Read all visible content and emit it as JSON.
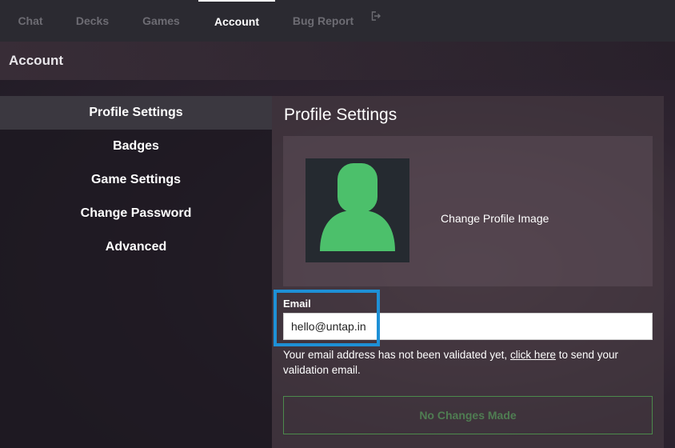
{
  "nav": {
    "items": [
      {
        "label": "Chat"
      },
      {
        "label": "Decks"
      },
      {
        "label": "Games"
      },
      {
        "label": "Account"
      },
      {
        "label": "Bug Report"
      }
    ],
    "logout_icon": "logout-icon"
  },
  "header": {
    "title": "Account"
  },
  "sidebar": {
    "items": [
      {
        "label": "Profile Settings"
      },
      {
        "label": "Badges"
      },
      {
        "label": "Game Settings"
      },
      {
        "label": "Change Password"
      },
      {
        "label": "Advanced"
      }
    ]
  },
  "content": {
    "title": "Profile Settings",
    "avatar_icon": "user-silhouette-icon",
    "avatar_color": "#4cc06b",
    "change_image_label": "Change Profile Image",
    "email_label": "Email",
    "email_value": "hello@untap.in",
    "notice_before": "Your email address has not been validated yet, ",
    "notice_link": "click here",
    "notice_after": " to send your validation email.",
    "save_label": "No Changes Made"
  },
  "colors": {
    "highlight": "#1e90d6",
    "button_border": "#4c8a4c"
  }
}
